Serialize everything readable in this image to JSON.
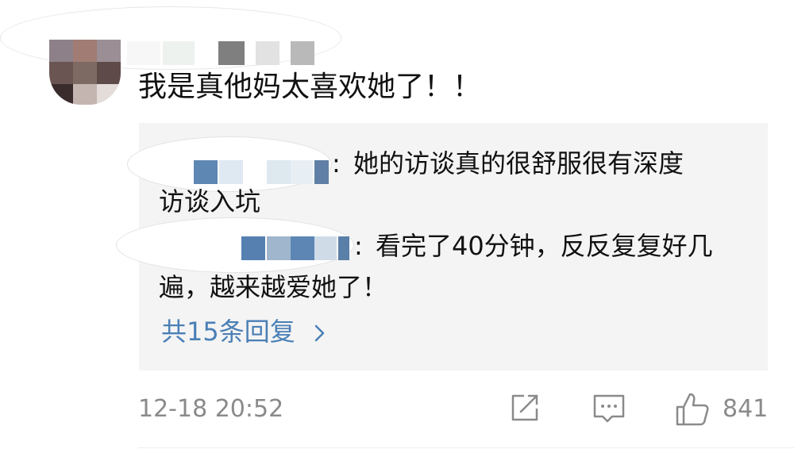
{
  "comment": {
    "author_name_redacted": true,
    "text": "我是真他妈太喜欢她了！！"
  },
  "replies": [
    {
      "author_name_redacted": true,
      "separator": ":",
      "text_line1": "她的访谈真的很舒服很有深度",
      "text_line2": "访谈入坑"
    },
    {
      "author_name_redacted": true,
      "separator": ":",
      "text_line1": "看完了40分钟，反反复复好几",
      "text_line2": "遍，越来越爱她了！"
    }
  ],
  "more_replies": {
    "label": "共15条回复"
  },
  "footer": {
    "timestamp": "12-18 20:52",
    "like_count": "841",
    "icons": [
      "share-icon",
      "comment-icon",
      "like-icon"
    ]
  },
  "colors": {
    "link_blue": "#4a7fb6",
    "meta_gray": "#8a8a8a",
    "reply_bg": "#f4f4f4",
    "text": "#111111"
  }
}
